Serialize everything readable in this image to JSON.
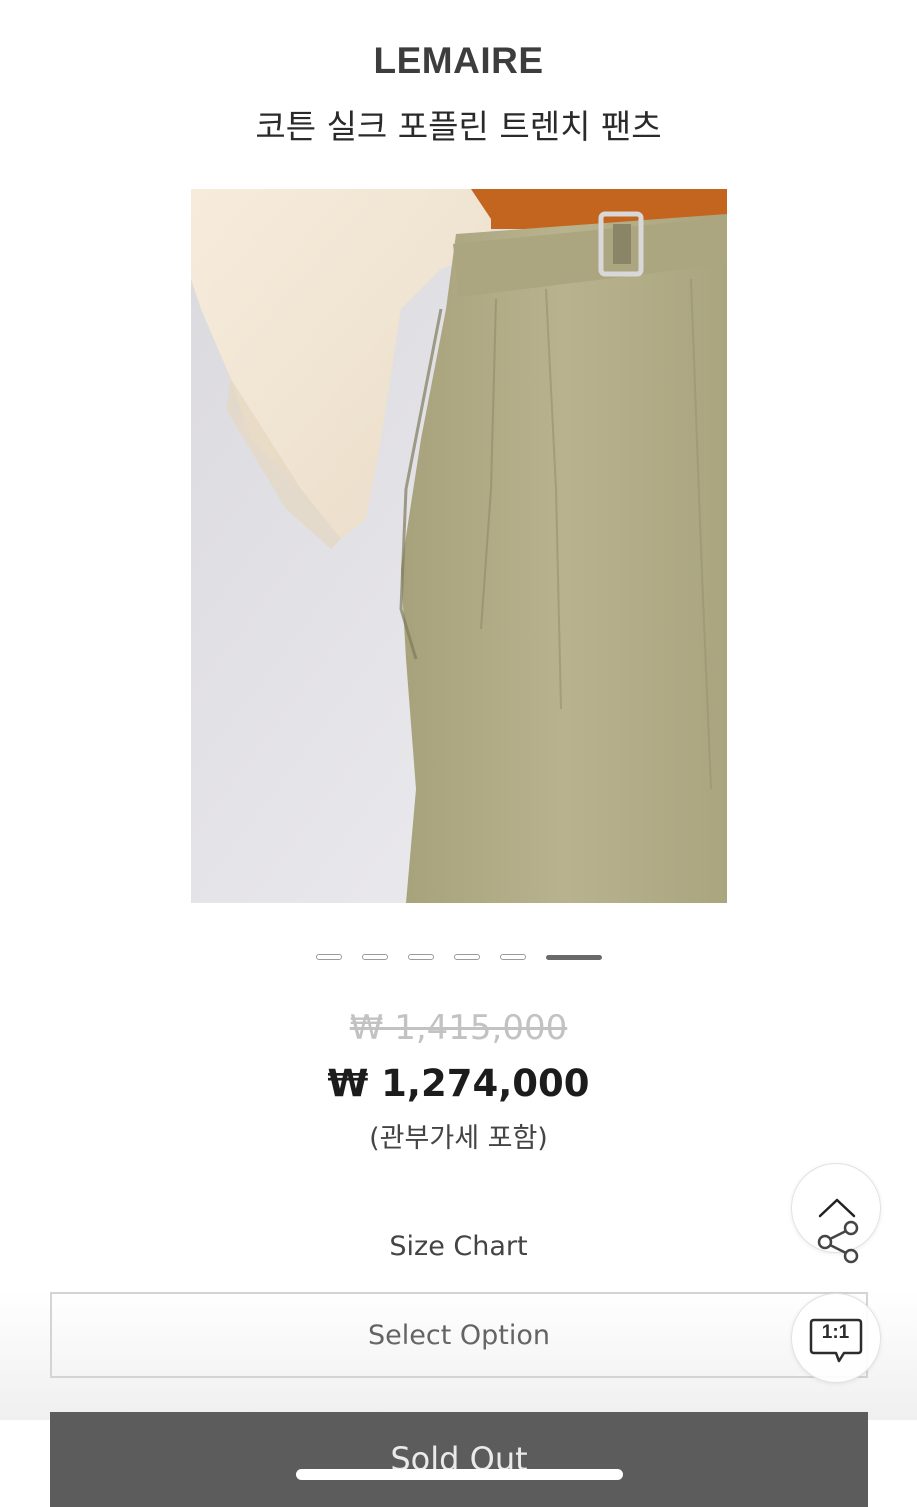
{
  "product": {
    "brand": "LEMAIRE",
    "name": "코튼 실크 포플린 트렌치 팬츠"
  },
  "gallery": {
    "image_count": 6,
    "active_index": 5
  },
  "pricing": {
    "original_price": "₩ 1,415,000",
    "sale_price": "₩ 1,274,000",
    "tax_note": "(관부가세 포함)"
  },
  "options": {
    "size_chart_label": "Size Chart",
    "select_placeholder": "Select Option"
  },
  "actions": {
    "sold_out_label": "Sold Out",
    "chat_label": "1:1"
  },
  "icons": {
    "scroll_top": "chevron-up-icon",
    "share": "share-icon",
    "chat": "chat-bubble-icon"
  },
  "colors": {
    "sold_out_bg": "#5c5c5c",
    "strikethrough_price": "#c2c2c2",
    "pants_khaki": "#b2ad86"
  }
}
